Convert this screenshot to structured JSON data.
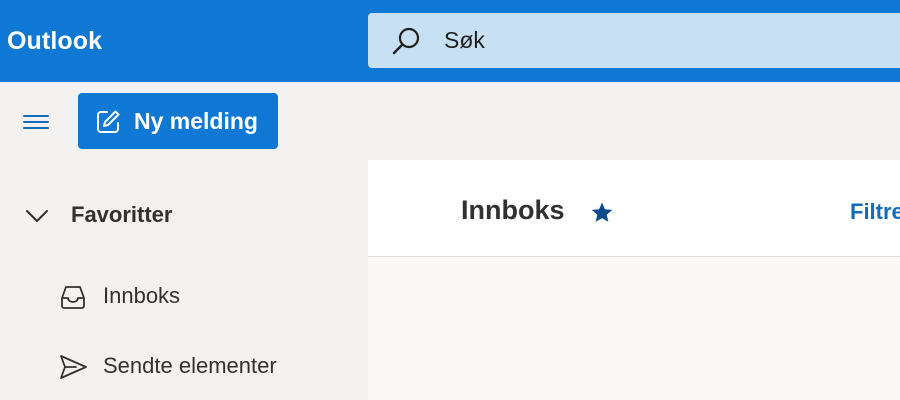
{
  "header": {
    "app_title": "Outlook",
    "search": {
      "placeholder": "Søk",
      "icon": "search-icon"
    }
  },
  "toolbar": {
    "menu_icon": "hamburger-icon",
    "new_message_label": "Ny melding",
    "new_message_icon": "compose-icon"
  },
  "sidebar": {
    "favorites_label": "Favoritter",
    "items": [
      {
        "label": "Innboks",
        "icon": "inbox-icon"
      },
      {
        "label": "Sendte elementer",
        "icon": "send-icon"
      }
    ]
  },
  "main": {
    "folder_title": "Innboks",
    "favorite_icon": "star-icon",
    "filter_label": "Filtrer"
  },
  "colors": {
    "brand_blue": "#0f78d4",
    "search_bg": "#c7e0f4",
    "nav_bg": "#f3f2f1",
    "star": "#0b4a8b"
  }
}
